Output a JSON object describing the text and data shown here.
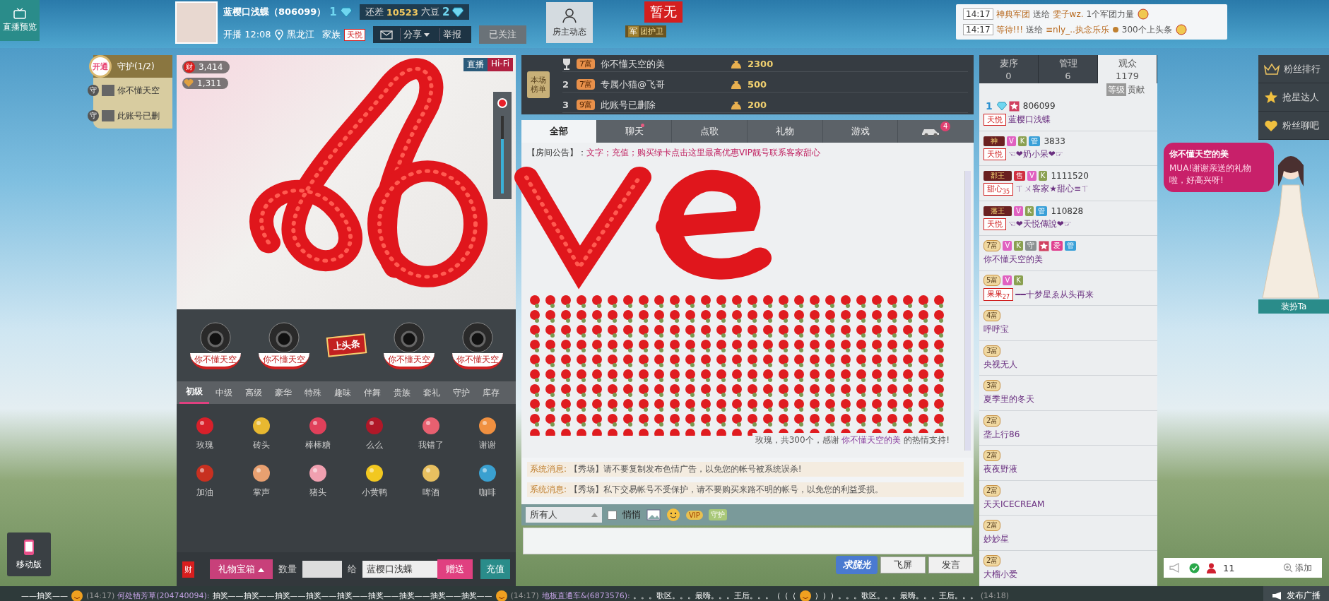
{
  "preview": {
    "label": "直播预览"
  },
  "host": {
    "name": "蓝樱口浅蝶（806099）",
    "level": "1",
    "gap_label": "还差",
    "gap_value": "10523",
    "gap_unit": "六豆",
    "next_level": "2",
    "start": "开播 12:08",
    "location": "黑龙江",
    "family_label": "家族",
    "family_tag": "天悦",
    "share": "分享",
    "report": "举报",
    "follow": "已关注"
  },
  "host_dynamics": {
    "label": "房主动态"
  },
  "flag": {
    "label": "暂无",
    "badge": "军",
    "badge_label": "团护卫"
  },
  "notices": [
    {
      "time": "14:17",
      "sender": "神典军团",
      "verb": "送给",
      "receiver": "雯子wz.",
      "gift": "1个军团力量"
    },
    {
      "time": "14:17",
      "sender": "等待!!!",
      "verb": "送给",
      "receiver": "≡nly_..执念乐乐",
      "gift": "300个上头条"
    }
  ],
  "guard": {
    "open_label": "开通",
    "title": "守护(1/2)",
    "members": [
      {
        "badge": "守",
        "name": "你不懂天空"
      },
      {
        "badge": "守",
        "name": "此账号已删"
      }
    ]
  },
  "mobile": {
    "label": "移动版"
  },
  "video": {
    "wealth_badge": "财",
    "wealth": "3,414",
    "charm": "1,311",
    "live": "直播",
    "hifi": "Hi-Fi",
    "volume": {
      "level": 0.7
    }
  },
  "headlines": [
    {
      "kind": "seat",
      "name": "你不懂天空"
    },
    {
      "kind": "seat",
      "name": "你不懂天空"
    },
    {
      "kind": "sign",
      "name": "上头条"
    },
    {
      "kind": "seat",
      "name": "你不懂天空"
    },
    {
      "kind": "seat",
      "name": "你不懂天空"
    }
  ],
  "gift_tabs": [
    {
      "label": "初级",
      "selected": true
    },
    {
      "label": "中级",
      "selected": false
    },
    {
      "label": "高级",
      "selected": false
    },
    {
      "label": "豪华",
      "selected": false
    },
    {
      "label": "特殊",
      "selected": false
    },
    {
      "label": "趣味",
      "selected": false
    },
    {
      "label": "伴舞",
      "selected": false
    },
    {
      "label": "贵族",
      "selected": false
    },
    {
      "label": "套礼",
      "selected": false
    },
    {
      "label": "守护",
      "selected": false
    },
    {
      "label": "库存",
      "selected": false
    }
  ],
  "gifts": [
    {
      "name": "玫瑰"
    },
    {
      "name": "砖头"
    },
    {
      "name": "棒棒糖"
    },
    {
      "name": "么么"
    },
    {
      "name": "我错了"
    },
    {
      "name": "谢谢"
    },
    {
      "name": "加油"
    },
    {
      "name": "掌声"
    },
    {
      "name": "猪头"
    },
    {
      "name": "小黄鸭"
    },
    {
      "name": "啤酒"
    },
    {
      "name": "咖啡"
    }
  ],
  "gift_bar": {
    "wealth_badge": "财",
    "treasure": "礼物宝箱",
    "qty_label": "数量",
    "to_label": "给",
    "recipient": "蓝樱口浅蝶",
    "send": "赠送",
    "recharge": "充值"
  },
  "rank_board": {
    "title": "本场榜单",
    "rows": [
      {
        "kind": "trophy",
        "tier": "7富",
        "name": "你不懂天空的美",
        "score": "2300"
      },
      {
        "kind": "number",
        "rank": "2",
        "tier": "7富",
        "name": "专属小猫@飞哥",
        "score": "500"
      },
      {
        "kind": "number",
        "rank": "3",
        "tier": "9富",
        "name": "此账号已删除",
        "score": "200"
      }
    ]
  },
  "chat_tabs": [
    {
      "kind": "text",
      "label": "全部",
      "selected": true,
      "dot": false
    },
    {
      "kind": "text",
      "label": "聊天",
      "selected": false,
      "dot": true
    },
    {
      "kind": "text",
      "label": "点歌",
      "selected": false,
      "dot": false
    },
    {
      "kind": "text",
      "label": "礼物",
      "selected": false,
      "dot": false
    },
    {
      "kind": "text",
      "label": "游戏",
      "selected": false,
      "dot": false
    },
    {
      "kind": "car",
      "count": "4",
      "selected": false,
      "dot": false
    }
  ],
  "announcement": {
    "label": "【房间公告】：",
    "text": "文字；充值；购买绿卡点击这里最高优惠VIP靓号联系客家甜心"
  },
  "gift_message": {
    "text": "玫瑰，共300个，感谢",
    "user": "你不懂天空的美",
    "suffix": "的热情支持!"
  },
  "system_messages": [
    {
      "label": "系统消息:",
      "text": "【秀场】请不要复制发布色情广告，以免您的帐号被系统误杀!"
    },
    {
      "label": "系统消息:",
      "text": "【秀场】私下交易帐号不受保护，请不要购买来路不明的帐号，以免您的利益受损。"
    }
  ],
  "chat_input": {
    "target": "所有人",
    "whisper_label": "悄悄",
    "whisper_checked": false,
    "vip": "VIP",
    "guard": "守护",
    "promo": "求脱光",
    "fly": "飞屏",
    "send": "发言"
  },
  "audience_tabs": [
    {
      "label": "麦序",
      "count": "0",
      "selected": false
    },
    {
      "label": "管理",
      "count": "6",
      "selected": false
    },
    {
      "label": "观众",
      "count": "1179",
      "selected": true
    }
  ],
  "sort": [
    {
      "label": "等级",
      "selected": true
    },
    {
      "label": "贡献",
      "selected": false
    }
  ],
  "users": [
    {
      "badges": [
        {
          "kind": "diamond",
          "text": "1"
        },
        {
          "kind": "star"
        }
      ],
      "id": "806099",
      "tag": {
        "text": "天悦"
      },
      "name": "蓝樱口浅蝶"
    },
    {
      "badges": [
        {
          "kind": "title",
          "text": "神"
        },
        {
          "kind": "v",
          "text": "V"
        },
        {
          "kind": "k",
          "text": "K"
        },
        {
          "kind": "admin",
          "text": "管"
        }
      ],
      "id": "3833",
      "tag": {
        "text": "天悦"
      },
      "name": "☜❤奶小呆❤☞"
    },
    {
      "badges": [
        {
          "kind": "title",
          "text": "郡王"
        },
        {
          "kind": "sell",
          "text": "售"
        },
        {
          "kind": "v",
          "text": "V"
        },
        {
          "kind": "k",
          "text": "K"
        }
      ],
      "id": "1111520",
      "tag": {
        "text": "甜心",
        "sub": "35"
      },
      "name": "ㄒㄨ客家★甜心≡ㄒ"
    },
    {
      "badges": [
        {
          "kind": "title",
          "text": "藩王"
        },
        {
          "kind": "v",
          "text": "V"
        },
        {
          "kind": "k",
          "text": "K"
        },
        {
          "kind": "admin",
          "text": "管"
        }
      ],
      "id": "110828",
      "tag": {
        "text": "天悦"
      },
      "name": "☜❤天悦傳說❤☞"
    },
    {
      "badges": [
        {
          "kind": "tier",
          "text": "7富"
        },
        {
          "kind": "v",
          "text": "V"
        },
        {
          "kind": "k",
          "text": "K"
        },
        {
          "kind": "guard",
          "text": "守"
        },
        {
          "kind": "star"
        },
        {
          "kind": "love",
          "text": "爱"
        },
        {
          "kind": "admin",
          "text": "管"
        }
      ],
      "name": "你不懂天空的美"
    },
    {
      "badges": [
        {
          "kind": "tier",
          "text": "5富"
        },
        {
          "kind": "v",
          "text": "V"
        },
        {
          "kind": "k",
          "text": "K"
        }
      ],
      "tag": {
        "text": "果果",
        "sub": "27"
      },
      "name": "━━十梦星ゑ从头再来"
    },
    {
      "badges": [
        {
          "kind": "tier",
          "text": "4富"
        }
      ],
      "name": "呼呼宝"
    },
    {
      "badges": [
        {
          "kind": "tier",
          "text": "3富"
        }
      ],
      "name": "央视无人"
    },
    {
      "badges": [
        {
          "kind": "tier",
          "text": "3富"
        }
      ],
      "name": "夏季里的冬天"
    },
    {
      "badges": [
        {
          "kind": "tier",
          "text": "2富"
        }
      ],
      "name": "垄上行86"
    },
    {
      "badges": [
        {
          "kind": "tier",
          "text": "2富"
        }
      ],
      "name": "夜夜野液"
    },
    {
      "badges": [
        {
          "kind": "tier",
          "text": "2富"
        }
      ],
      "name": "天天ICECREAM"
    },
    {
      "badges": [
        {
          "kind": "tier",
          "text": "2富"
        }
      ],
      "name": "妙妙星"
    },
    {
      "badges": [
        {
          "kind": "tier",
          "text": "2富"
        }
      ],
      "name": "大榴小爱"
    }
  ],
  "fan_menu": [
    {
      "kind": "crown",
      "label": "粉丝排行"
    },
    {
      "kind": "star",
      "label": "抢星达人"
    },
    {
      "kind": "heart",
      "label": "粉丝聊吧"
    }
  ],
  "bubble": {
    "name": "你不懂天空的美",
    "text": "MUA!谢谢亲送的礼物啦，好高兴呀!"
  },
  "dress": {
    "label": "装扮Ta"
  },
  "tools": {
    "count": "11",
    "add": "添加"
  },
  "ticker": [
    {
      "kind": "message",
      "text": "——抽奖——"
    },
    {
      "kind": "emoji"
    },
    {
      "kind": "time",
      "text": "(14:17)"
    },
    {
      "kind": "user",
      "text": "何处牺芳草(204740094):"
    },
    {
      "kind": "message",
      "text": "抽奖——抽奖——抽奖——抽奖——抽奖——抽奖——抽奖——抽奖——抽奖——"
    },
    {
      "kind": "emoji"
    },
    {
      "kind": "time",
      "text": "(14:17)"
    },
    {
      "kind": "user",
      "text": "地板直通车&(6873576):"
    },
    {
      "kind": "message",
      "text": "。。。歌区。。。最嗨。。。王后。。。（（（"
    },
    {
      "kind": "emoji"
    },
    {
      "kind": "message",
      "text": "）））。。。歌区。。。最嗨。。。王后。。。"
    },
    {
      "kind": "time",
      "text": "(14:18)"
    }
  ],
  "broadcast": {
    "label": "发布广播"
  }
}
